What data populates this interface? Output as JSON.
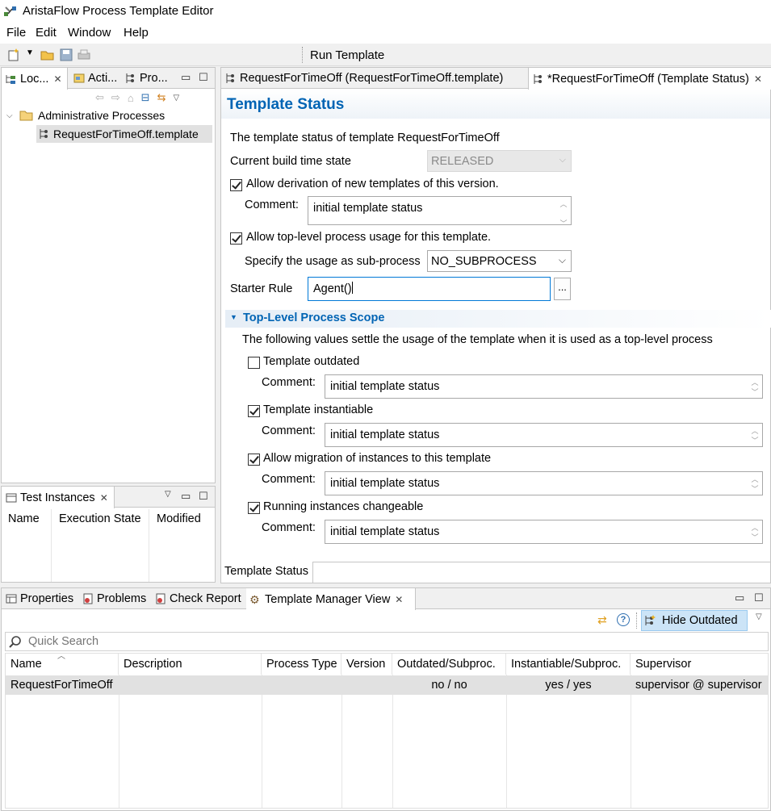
{
  "app": {
    "title": "AristaFlow Process Template Editor"
  },
  "menu": [
    "File",
    "Edit",
    "Window",
    "Help"
  ],
  "toolbar": {
    "run_template": "Run Template"
  },
  "left_pane": {
    "tabs": [
      "Loc...",
      "Acti...",
      "Pro..."
    ],
    "tree": {
      "folder": "Administrative Processes",
      "item": "RequestForTimeOff.template"
    }
  },
  "test_instances": {
    "title": "Test Instances",
    "columns": [
      "Name",
      "Execution State",
      "Modified"
    ]
  },
  "editor": {
    "tabs": [
      "RequestForTimeOff (RequestForTimeOff.template)",
      "*RequestForTimeOff (Template Status)"
    ],
    "heading": "Template Status",
    "intro": "The template status of template RequestForTimeOff",
    "build_state_label": "Current build time state",
    "build_state_value": "RELEASED",
    "allow_derivation": {
      "label": "Allow derivation of new templates of this version.",
      "checked": true
    },
    "comment_label": "Comment:",
    "derivation_comment": "initial template status",
    "allow_toplevel": {
      "label": "Allow top-level process usage for this template.",
      "checked": true
    },
    "subprocess_label": "Specify the usage as sub-process",
    "subprocess_value": "NO_SUBPROCESS",
    "starter_rule_label": "Starter Rule",
    "starter_rule_value": "Agent()",
    "starter_rule_button": "...",
    "scope_section": {
      "title": "Top-Level Process Scope",
      "description": "The following values settle the usage of the template when it is used as a top-level process",
      "items": [
        {
          "label": "Template outdated",
          "checked": false,
          "comment": "initial template status"
        },
        {
          "label": "Template instantiable",
          "checked": true,
          "comment": "initial template status"
        },
        {
          "label": "Allow migration of instances to this template",
          "checked": true,
          "comment": "initial template status"
        },
        {
          "label": "Running instances changeable",
          "checked": true,
          "comment": "initial template status"
        }
      ]
    },
    "bottom_tab": "Template Status"
  },
  "bottom_pane": {
    "tabs": [
      "Properties",
      "Problems",
      "Check Report",
      "Template Manager View"
    ],
    "hide_outdated": "Hide Outdated",
    "search_placeholder": "Quick Search",
    "columns": [
      "Name",
      "Description",
      "Process Type",
      "Version",
      "Outdated/Subproc.",
      "Instantiable/Subproc.",
      "Supervisor"
    ],
    "rows": [
      [
        "RequestForTimeOff",
        "",
        "",
        "",
        "no / no",
        "yes / yes",
        "supervisor @ supervisor"
      ]
    ]
  },
  "colors": {
    "accent": "#0070c0",
    "section_title": "#0064b4",
    "selection": "#e1e1e1"
  }
}
